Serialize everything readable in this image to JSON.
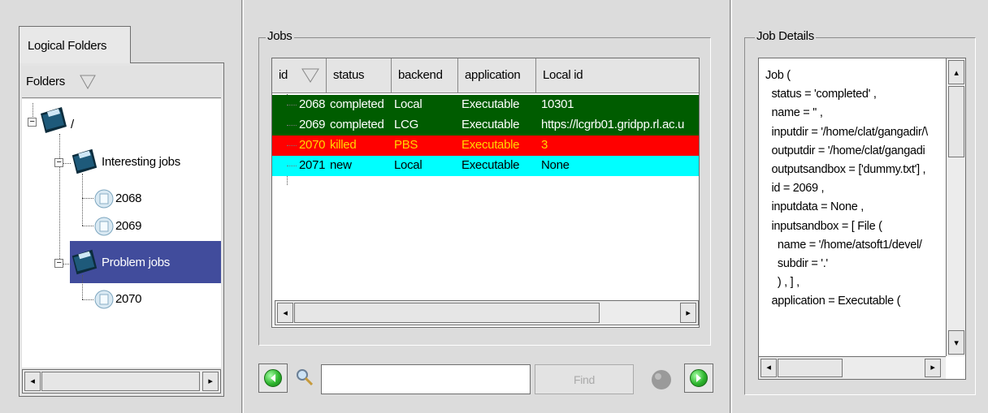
{
  "left_pane": {
    "tab_label": "Logical Folders",
    "folders_header": "Folders",
    "tree": {
      "root_label": "/",
      "interesting": "Interesting jobs",
      "job_2068": "2068",
      "job_2069": "2069",
      "problem": "Problem jobs",
      "job_2070": "2070"
    }
  },
  "jobs_pane": {
    "title": "Jobs",
    "columns": [
      "id",
      "status",
      "backend",
      "application",
      "Local id"
    ],
    "rows": [
      {
        "id": "2068",
        "status": "completed",
        "backend": "Local",
        "application": "Executable",
        "local_id": "10301",
        "color": "#005c00"
      },
      {
        "id": "2069",
        "status": "completed",
        "backend": "LCG",
        "application": "Executable",
        "local_id": "https://lcgrb01.gridpp.rl.ac.u",
        "color": "#005c00"
      },
      {
        "id": "2070",
        "status": "killed",
        "backend": "PBS",
        "application": "Executable",
        "local_id": "3",
        "color": "#ff0000"
      },
      {
        "id": "2071",
        "status": "new",
        "backend": "Local",
        "application": "Executable",
        "local_id": "None",
        "color": "#00ffff"
      }
    ],
    "find_label": "Find",
    "search_value": ""
  },
  "details_pane": {
    "title": "Job Details",
    "lines": [
      "Job (",
      "  status = 'completed' ,",
      "  name = '' ,",
      "  inputdir = '/home/clat/gangadir/\\",
      "  outputdir = '/home/clat/gangadi",
      "  outputsandbox = ['dummy.txt'] ,",
      "  id = 2069 ,",
      "  inputdata = None ,",
      "  inputsandbox = [ File (",
      "    name = '/home/atsoft1/devel/",
      "    subdir = '.'",
      "    ) , ] ,",
      "  application = Executable ("
    ]
  },
  "colors": {
    "selection": "#414c9c",
    "completed": "#005c00",
    "killed": "#ff0000",
    "new": "#00ffff"
  }
}
